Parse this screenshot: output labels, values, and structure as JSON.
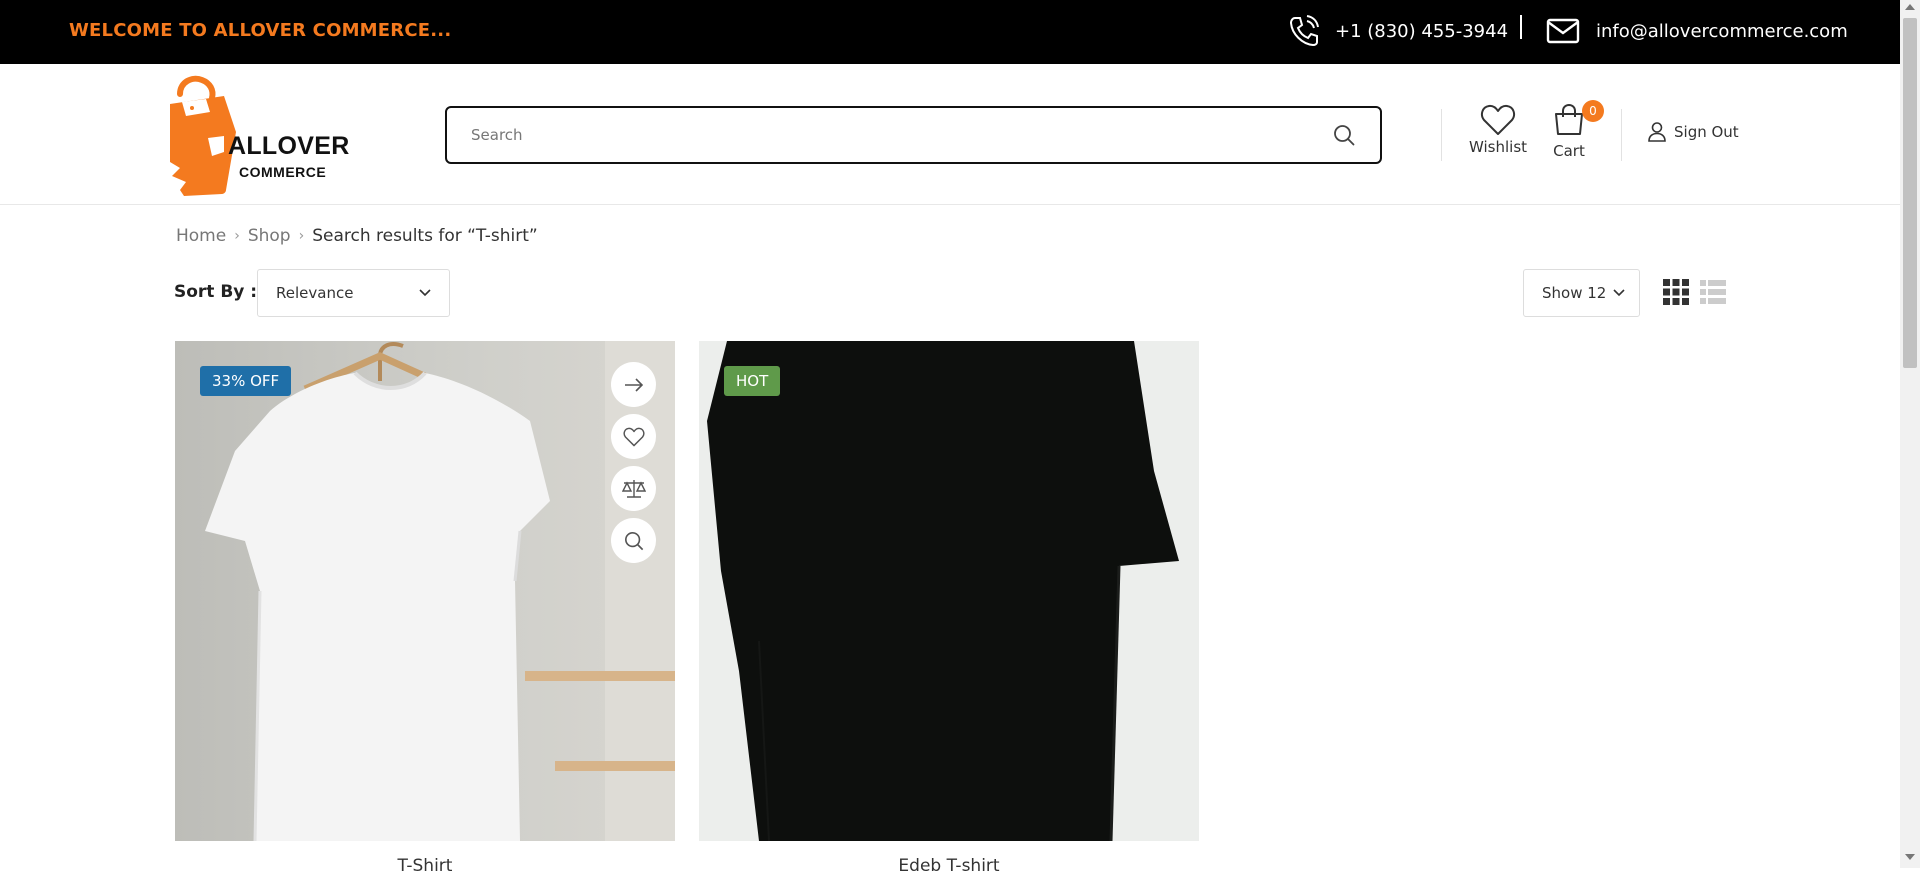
{
  "topbar": {
    "welcome": "WELCOME TO ALLOVER COMMERCE...",
    "phone": "+1 (830) 455-3944",
    "email": "info@allovercommerce.com"
  },
  "header": {
    "logo_line1": "ALLOVER",
    "logo_line2": "COMMERCE",
    "search_placeholder": "Search",
    "search_value": "",
    "wishlist_label": "Wishlist",
    "cart_label": "Cart",
    "cart_count": "0",
    "signout_label": "Sign Out"
  },
  "breadcrumb": {
    "items": [
      "Home",
      "Shop"
    ],
    "current": "Search results for “T-shirt”"
  },
  "toolbar": {
    "sort_label": "Sort By :",
    "sort_value": "Relevance",
    "show_value": "Show 12"
  },
  "products": [
    {
      "badge": "33% OFF",
      "title": "T-Shirt"
    },
    {
      "badge": "HOT",
      "title": "Edeb T-shirt"
    }
  ],
  "colors": {
    "accent": "#f47a1f",
    "topbar_bg": "#000000",
    "badge_off": "#1f6fa8",
    "badge_hot": "#5f9a4a"
  },
  "icons": [
    "phone-icon",
    "mail-icon",
    "search-icon",
    "heart-icon",
    "cart-icon",
    "user-icon",
    "grid-view-icon",
    "list-view-icon",
    "arrow-right-icon",
    "compare-icon",
    "zoom-icon"
  ]
}
